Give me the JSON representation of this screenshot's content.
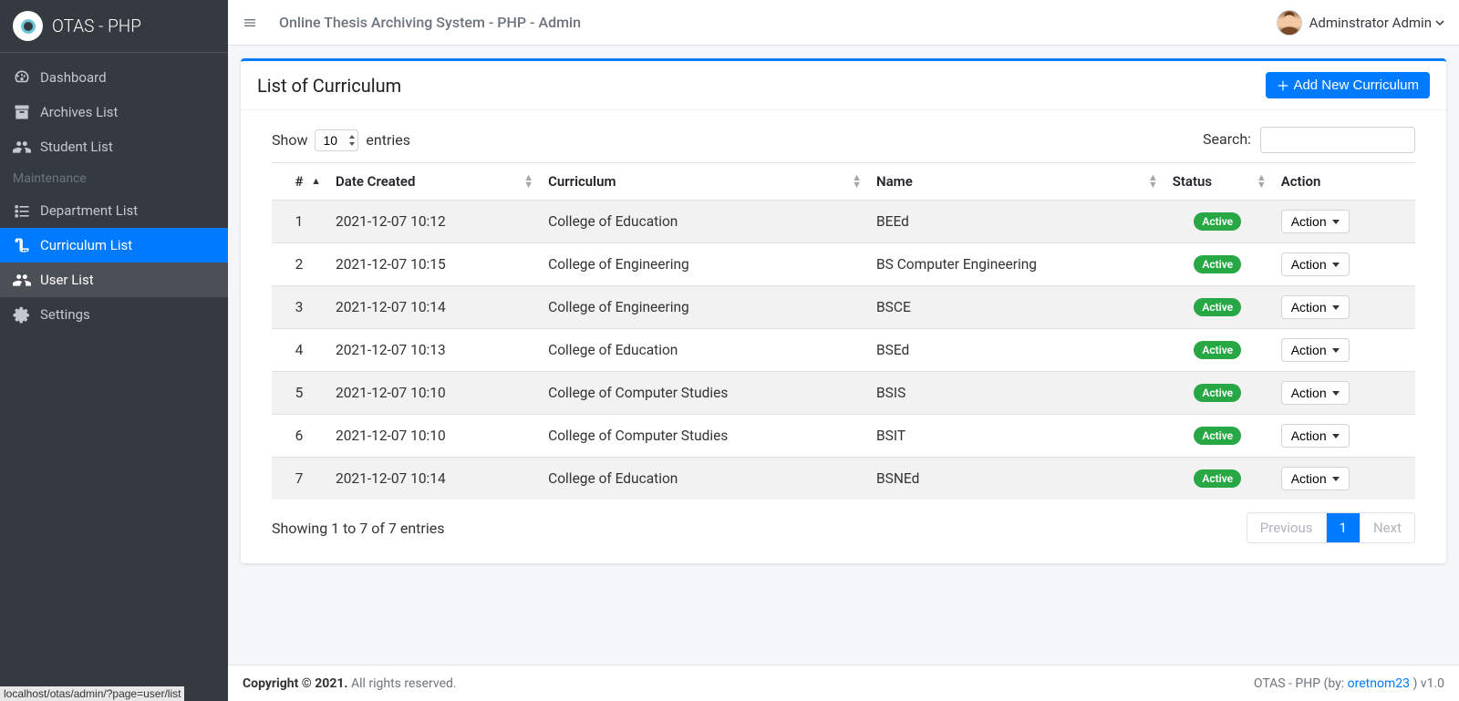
{
  "brand": "OTAS - PHP",
  "topbar": {
    "title": "Online Thesis Archiving System - PHP - Admin",
    "user": "Adminstrator Admin"
  },
  "sidebar": {
    "items": [
      {
        "label": "Dashboard"
      },
      {
        "label": "Archives List"
      },
      {
        "label": "Student List"
      }
    ],
    "maintenance_header": "Maintenance",
    "maintenance": [
      {
        "label": "Department List"
      },
      {
        "label": "Curriculum List"
      },
      {
        "label": "User List"
      },
      {
        "label": "Settings"
      }
    ]
  },
  "card": {
    "title": "List of Curriculum",
    "add_button": "Add New Curriculum"
  },
  "datatable": {
    "show_label": "Show",
    "entries_label": "entries",
    "length_value": "10",
    "search_label": "Search:",
    "search_value": "",
    "info": "Showing 1 to 7 of 7 entries",
    "headers": {
      "num": "#",
      "date": "Date Created",
      "curriculum": "Curriculum",
      "name": "Name",
      "status": "Status",
      "action": "Action"
    },
    "rows": [
      {
        "num": "1",
        "date": "2021-12-07 10:12",
        "curriculum": "College of Education",
        "name": "BEEd",
        "status": "Active"
      },
      {
        "num": "2",
        "date": "2021-12-07 10:15",
        "curriculum": "College of Engineering",
        "name": "BS Computer Engineering",
        "status": "Active"
      },
      {
        "num": "3",
        "date": "2021-12-07 10:14",
        "curriculum": "College of Engineering",
        "name": "BSCE",
        "status": "Active"
      },
      {
        "num": "4",
        "date": "2021-12-07 10:13",
        "curriculum": "College of Education",
        "name": "BSEd",
        "status": "Active"
      },
      {
        "num": "5",
        "date": "2021-12-07 10:10",
        "curriculum": "College of Computer Studies",
        "name": "BSIS",
        "status": "Active"
      },
      {
        "num": "6",
        "date": "2021-12-07 10:10",
        "curriculum": "College of Computer Studies",
        "name": "BSIT",
        "status": "Active"
      },
      {
        "num": "7",
        "date": "2021-12-07 10:14",
        "curriculum": "College of Education",
        "name": "BSNEd",
        "status": "Active"
      }
    ],
    "action_label": "Action",
    "pagination": {
      "prev": "Previous",
      "next": "Next",
      "page": "1"
    }
  },
  "footer": {
    "copyright_strong": "Copyright © 2021.",
    "copyright_rest": " All rights reserved.",
    "right_prefix": "OTAS - PHP (by: ",
    "right_link": "oretnom23",
    "right_suffix": " ) v1.0"
  },
  "statusbar": "localhost/otas/admin/?page=user/list"
}
